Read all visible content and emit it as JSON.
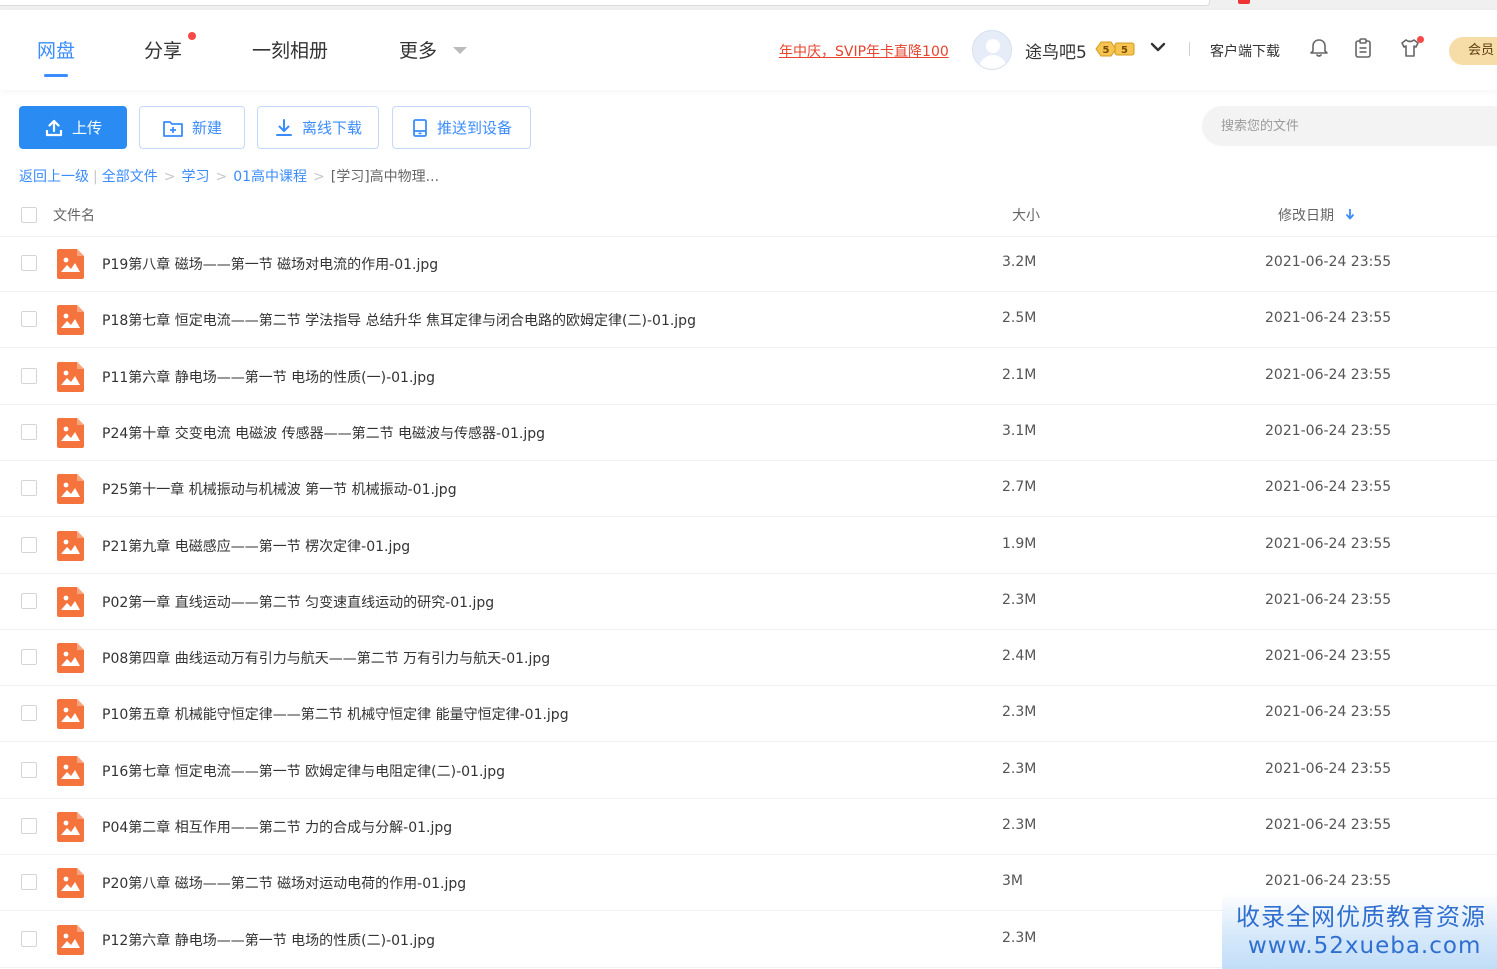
{
  "nav": {
    "tabs": [
      {
        "label": "网盘"
      },
      {
        "label": "分享"
      },
      {
        "label": "一刻相册"
      },
      {
        "label": "更多"
      }
    ]
  },
  "header": {
    "promo": "年中庆，SVIP年卡直降100",
    "username": "途鸟吧5",
    "vip_level": "5",
    "client_download": "客户端下载",
    "member_button": "会员"
  },
  "toolbar": {
    "upload": "上传",
    "new": "新建",
    "offline_download": "离线下载",
    "push_device": "推送到设备",
    "search_placeholder": "搜索您的文件"
  },
  "breadcrumb": {
    "back": "返回上一级",
    "items": [
      "全部文件",
      "学习",
      "01高中课程"
    ],
    "current": "[学习]高中物理..."
  },
  "columns": {
    "name": "文件名",
    "size": "大小",
    "modified": "修改日期"
  },
  "files": [
    {
      "name": "P19第八章 磁场——第一节 磁场对电流的作用-01.jpg",
      "size": "3.2M",
      "date": "2021-06-24 23:55"
    },
    {
      "name": "P18第七章 恒定电流——第二节 学法指导 总结升华 焦耳定律与闭合电路的欧姆定律(二)-01.jpg",
      "size": "2.5M",
      "date": "2021-06-24 23:55"
    },
    {
      "name": "P11第六章 静电场——第一节 电场的性质(一)-01.jpg",
      "size": "2.1M",
      "date": "2021-06-24 23:55"
    },
    {
      "name": "P24第十章 交变电流 电磁波 传感器——第二节 电磁波与传感器-01.jpg",
      "size": "3.1M",
      "date": "2021-06-24 23:55"
    },
    {
      "name": "P25第十一章 机械振动与机械波 第一节 机械振动-01.jpg",
      "size": "2.7M",
      "date": "2021-06-24 23:55"
    },
    {
      "name": "P21第九章 电磁感应——第一节 楞次定律-01.jpg",
      "size": "1.9M",
      "date": "2021-06-24 23:55"
    },
    {
      "name": "P02第一章 直线运动——第二节 匀变速直线运动的研究-01.jpg",
      "size": "2.3M",
      "date": "2021-06-24 23:55"
    },
    {
      "name": "P08第四章 曲线运动万有引力与航天——第二节 万有引力与航天-01.jpg",
      "size": "2.4M",
      "date": "2021-06-24 23:55"
    },
    {
      "name": "P10第五章 机械能守恒定律——第二节 机械守恒定律 能量守恒定律-01.jpg",
      "size": "2.3M",
      "date": "2021-06-24 23:55"
    },
    {
      "name": "P16第七章 恒定电流——第一节 欧姆定律与电阻定律(二)-01.jpg",
      "size": "2.3M",
      "date": "2021-06-24 23:55"
    },
    {
      "name": "P04第二章 相互作用——第二节 力的合成与分解-01.jpg",
      "size": "2.3M",
      "date": "2021-06-24 23:55"
    },
    {
      "name": "P20第八章 磁场——第二节 磁场对运动电荷的作用-01.jpg",
      "size": "3M",
      "date": "2021-06-24 23:55"
    },
    {
      "name": "P12第六章 静电场——第一节 电场的性质(二)-01.jpg",
      "size": "2.3M",
      "date": ""
    }
  ],
  "watermark": {
    "line1": "收录全网优质教育资源",
    "line2": "www.52xueba.com"
  },
  "colors": {
    "accent": "#3b8cff",
    "primary_button": "#2a8cf3",
    "image_file_icon": "#f5743e",
    "promo": "#e6442e",
    "notification_dot": "#f54a45"
  },
  "icons": {
    "upload": "upload-icon",
    "new": "new-folder-icon",
    "offline_download": "download-icon",
    "push_device": "device-icon",
    "notifications": "bell-icon",
    "tasks": "clipboard-icon",
    "skin": "tshirt-icon",
    "sort": "sort-down-arrow-icon",
    "file": "image-file-icon"
  }
}
